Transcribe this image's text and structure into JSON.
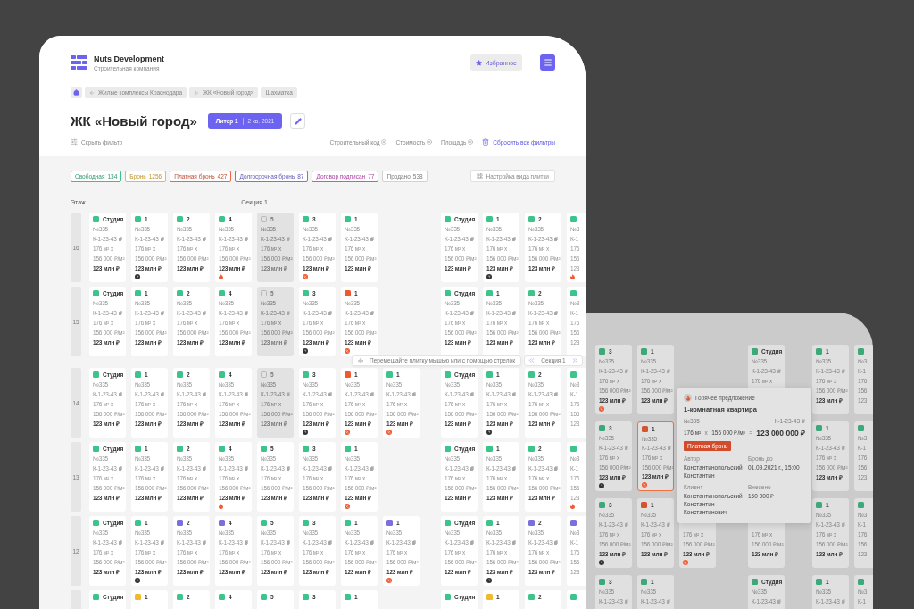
{
  "header": {
    "company": "Nuts Development",
    "subtitle": "Строительная компания",
    "favorites": "Избранное"
  },
  "breadcrumbs": [
    {
      "kind": "home"
    },
    {
      "kind": "back",
      "label": "Жилые комплексы Краснодара"
    },
    {
      "kind": "back",
      "label": "ЖК «Новый город»"
    },
    {
      "kind": "plain",
      "label": "Шахматка"
    }
  ],
  "title": {
    "text": "ЖК «Новый город»",
    "building": "Литер 1",
    "quarter": "2 кв. 2021"
  },
  "filters": {
    "toggle": "Скрыть фильтр",
    "chips": [
      "Строительный код",
      "Стоимость",
      "Площадь"
    ],
    "reset": "Сбросить все фильтры"
  },
  "legend": [
    {
      "label": "Свободная",
      "count": "134",
      "color": "#3fc089"
    },
    {
      "label": "Бронь",
      "count": "1256",
      "color": "#f0b83a"
    },
    {
      "label": "Платная бронь",
      "count": "427",
      "color": "#ec6547"
    },
    {
      "label": "Долгосрочная бронь",
      "count": "87",
      "color": "#7a72e6"
    },
    {
      "label": "Договор подписан",
      "count": "77",
      "color": "#d24fc6"
    },
    {
      "label": "Продано",
      "count": "538",
      "color": "#d2d2d2"
    }
  ],
  "view_settings": "Настройка вида плитки",
  "floors": {
    "floor_label": "Этаж",
    "section_label": "Секция 1",
    "rows": [
      {
        "floor": "16",
        "section_1": [
          {
            "kind": "full",
            "color": "#3cc48a",
            "rooms": "Студия",
            "number": "№335",
            "code": "К-1-23-43",
            "area": "176 м²",
            "op": "x",
            "price": "156 000 ₽/м²",
            "total": "123 млн ₽"
          },
          {
            "kind": "full",
            "color": "#3cc48a",
            "rooms": "1",
            "number": "№335",
            "code": "К-1-23-43",
            "area": "176 м²",
            "op": "x",
            "price": "156 000 ₽/м²",
            "total": "123 млн ₽",
            "badge": {
              "kind": "clock"
            }
          },
          {
            "kind": "full",
            "color": "#3cc48a",
            "rooms": "2",
            "number": "№335",
            "code": "К-1-23-43",
            "area": "176 м²",
            "op": "x",
            "price": "156 000 ₽/м²",
            "total": "123 млн ₽"
          },
          {
            "kind": "full",
            "color": "#3cc48a",
            "rooms": "4",
            "number": "№335",
            "code": "К-1-23-43",
            "area": "176 м²",
            "op": "x",
            "price": "156 000 ₽/м²",
            "total": "123 млн ₽",
            "badge": {
              "kind": "fire"
            }
          },
          {
            "kind": "sold",
            "rooms": "5",
            "number": "№335",
            "code": "К-1-23-43",
            "area": "176 м²",
            "op": "x",
            "price": "156 000 ₽/м²",
            "total": "123 млн ₽"
          },
          {
            "kind": "full",
            "color": "#3cc48a",
            "rooms": "3",
            "number": "№335",
            "code": "К-1-23-43",
            "area": "176 м²",
            "op": "x",
            "price": "156 000 ₽/м²",
            "total": "123 млн ₽",
            "badge": {
              "kind": "percent"
            }
          },
          {
            "kind": "full",
            "color": "#3cc48a",
            "rooms": "1",
            "number": "№335",
            "code": "К-1-23-43",
            "area": "176 м²",
            "op": "x",
            "price": "156 000 ₽/м²",
            "total": "123 млн ₽"
          },
          {
            "kind": "empty"
          }
        ],
        "section_2": [
          {
            "kind": "full",
            "color": "#3cc48a",
            "rooms": "Студия",
            "number": "№335",
            "code": "К-1-23-43",
            "area": "176 м²",
            "op": "x",
            "price": "156 000 ₽/м²",
            "total": "123 млн ₽"
          },
          {
            "kind": "full",
            "color": "#3cc48a",
            "rooms": "1",
            "number": "№335",
            "code": "К-1-23-43",
            "area": "176 м²",
            "op": "x",
            "price": "156 000 ₽/м²",
            "total": "123 млн ₽",
            "badge": {
              "kind": "clock"
            }
          },
          {
            "kind": "full",
            "color": "#3cc48a",
            "rooms": "2",
            "number": "№335",
            "code": "К-1-23-43",
            "area": "176 м²",
            "op": "x",
            "price": "156 000 ₽/м²",
            "total": "123 млн ₽"
          },
          {
            "kind": "cut",
            "color": "#3cc48a",
            "lines": [
              "№3",
              "К-1",
              "176",
              "156",
              "123"
            ],
            "badge": {
              "kind": "fire"
            }
          }
        ]
      },
      {
        "floor": "15",
        "section_1": [
          {
            "kind": "full",
            "color": "#3cc48a",
            "rooms": "Студия",
            "number": "№335",
            "code": "К-1-23-43",
            "area": "176 м²",
            "op": "x",
            "price": "156 000 ₽/м²",
            "total": "123 млн ₽"
          },
          {
            "kind": "full",
            "color": "#3cc48a",
            "rooms": "1",
            "number": "№335",
            "code": "К-1-23-43",
            "area": "176 м²",
            "op": "x",
            "price": "156 000 ₽/м²",
            "total": "123 млн ₽"
          },
          {
            "kind": "full",
            "color": "#3cc48a",
            "rooms": "2",
            "number": "№335",
            "code": "К-1-23-43",
            "area": "176 м²",
            "op": "x",
            "price": "156 000 ₽/м²",
            "total": "123 млн ₽"
          },
          {
            "kind": "full",
            "color": "#3cc48a",
            "rooms": "4",
            "number": "№335",
            "code": "К-1-23-43",
            "area": "176 м²",
            "op": "x",
            "price": "156 000 ₽/м²",
            "total": "123 млн ₽"
          },
          {
            "kind": "sold",
            "rooms": "5",
            "number": "№335",
            "code": "К-1-23-43",
            "area": "176 м²",
            "op": "x",
            "price": "156 000 ₽/м²",
            "total": "123 млн ₽"
          },
          {
            "kind": "full",
            "color": "#3cc48a",
            "rooms": "3",
            "number": "№335",
            "code": "К-1-23-43",
            "area": "176 м²",
            "op": "x",
            "price": "156 000 ₽/м²",
            "total": "123 млн ₽",
            "badge": {
              "kind": "clock"
            }
          },
          {
            "kind": "full",
            "color": "#f0582f",
            "rooms": "1",
            "number": "№335",
            "code": "К-1-23-43",
            "area": "176 м²",
            "op": "x",
            "price": "156 000 ₽/м²",
            "total": "123 млн ₽",
            "badge": {
              "kind": "percent"
            }
          },
          {
            "kind": "empty"
          }
        ],
        "section_2": [
          {
            "kind": "full",
            "color": "#3cc48a",
            "rooms": "Студия",
            "number": "№335",
            "code": "К-1-23-43",
            "area": "176 м²",
            "op": "x",
            "price": "156 000 ₽/м²",
            "total": "123 млн ₽"
          },
          {
            "kind": "full",
            "color": "#3cc48a",
            "rooms": "1",
            "number": "№335",
            "code": "К-1-23-43",
            "area": "176 м²",
            "op": "x",
            "price": "156 000 ₽/м²",
            "total": "123 млн ₽"
          },
          {
            "kind": "full",
            "color": "#3cc48a",
            "rooms": "2",
            "number": "№335",
            "code": "К-1-23-43",
            "area": "176 м²",
            "op": "x",
            "price": "156 000 ₽/м²",
            "total": "123 млн ₽"
          },
          {
            "kind": "cut",
            "color": "#3cc48a",
            "lines": [
              "№3",
              "К-1",
              "176",
              "156",
              "123"
            ]
          }
        ]
      },
      {
        "floor": "14",
        "section_1": [
          {
            "kind": "full",
            "color": "#3cc48a",
            "rooms": "Студия",
            "number": "№335",
            "code": "К-1-23-43",
            "area": "176 м²",
            "op": "x",
            "price": "156 000 ₽/м²",
            "total": "123 млн ₽"
          },
          {
            "kind": "full",
            "color": "#3cc48a",
            "rooms": "1",
            "number": "№335",
            "code": "К-1-23-43",
            "area": "176 м²",
            "op": "x",
            "price": "156 000 ₽/м²",
            "total": "123 млн ₽"
          },
          {
            "kind": "full",
            "color": "#3cc48a",
            "rooms": "2",
            "number": "№335",
            "code": "К-1-23-43",
            "area": "176 м²",
            "op": "x",
            "price": "156 000 ₽/м²",
            "total": "123 млн ₽"
          },
          {
            "kind": "full",
            "color": "#3cc48a",
            "rooms": "4",
            "number": "№335",
            "code": "К-1-23-43",
            "area": "176 м²",
            "op": "x",
            "price": "156 000 ₽/м²",
            "total": "123 млн ₽"
          },
          {
            "kind": "sold",
            "rooms": "5",
            "number": "№335",
            "code": "К-1-23-43",
            "area": "176 м²",
            "op": "x",
            "price": "156 000 ₽/м²",
            "total": "123 млн ₽"
          },
          {
            "kind": "full",
            "color": "#3cc48a",
            "rooms": "3",
            "number": "№335",
            "code": "К-1-23-43",
            "area": "176 м²",
            "op": "x",
            "price": "156 000 ₽/м²",
            "total": "123 млн ₽",
            "badge": {
              "kind": "clock"
            }
          },
          {
            "kind": "full",
            "color": "#f0582f",
            "rooms": "1",
            "number": "№335",
            "code": "К-1-23-43",
            "area": "176 м²",
            "op": "x",
            "price": "156 000 ₽/м²",
            "total": "123 млн ₽",
            "badge": {
              "kind": "percent"
            }
          },
          {
            "kind": "full",
            "color": "#3cc48a",
            "rooms": "1",
            "number": "№335",
            "code": "К-1-23-43",
            "area": "176 м²",
            "op": "x",
            "price": "156 000 ₽/м²",
            "total": "123 млн ₽",
            "badge": {
              "kind": "percent"
            }
          }
        ],
        "section_2": [
          {
            "kind": "full",
            "color": "#3cc48a",
            "rooms": "Студия",
            "number": "№335",
            "code": "К-1-23-43",
            "area": "176 м²",
            "op": "x",
            "price": "156 000 ₽/м²",
            "total": "123 млн ₽"
          },
          {
            "kind": "full",
            "color": "#3cc48a",
            "rooms": "1",
            "number": "№335",
            "code": "К-1-23-43",
            "area": "176 м²",
            "op": "x",
            "price": "156 000 ₽/м²",
            "total": "123 млн ₽",
            "badge": {
              "kind": "clock"
            }
          },
          {
            "kind": "full",
            "color": "#3cc48a",
            "rooms": "2",
            "number": "№335",
            "code": "К-1-23-43",
            "area": "176 м²",
            "op": "x",
            "price": "156 000 ₽/м²",
            "total": "123 млн ₽"
          },
          {
            "kind": "cut",
            "color": "#3cc48a",
            "lines": [
              "№3",
              "К-1",
              "176",
              "156",
              "123"
            ]
          }
        ]
      },
      {
        "floor": "13",
        "section_1": [
          {
            "kind": "full",
            "color": "#3cc48a",
            "rooms": "Студия",
            "number": "№335",
            "code": "К-1-23-43",
            "area": "176 м²",
            "op": "x",
            "price": "156 000 ₽/м²",
            "total": "123 млн ₽"
          },
          {
            "kind": "full",
            "color": "#3cc48a",
            "rooms": "1",
            "number": "№335",
            "code": "К-1-23-43",
            "area": "176 м²",
            "op": "x",
            "price": "156 000 ₽/м²",
            "total": "123 млн ₽"
          },
          {
            "kind": "full",
            "color": "#3cc48a",
            "rooms": "2",
            "number": "№335",
            "code": "К-1-23-43",
            "area": "176 м²",
            "op": "x",
            "price": "156 000 ₽/м²",
            "total": "123 млн ₽"
          },
          {
            "kind": "full",
            "color": "#3cc48a",
            "rooms": "4",
            "number": "№335",
            "code": "К-1-23-43",
            "area": "176 м²",
            "op": "x",
            "price": "156 000 ₽/м²",
            "total": "123 млн ₽",
            "badge": {
              "kind": "fire"
            }
          },
          {
            "kind": "full",
            "color": "#3cc48a",
            "rooms": "5",
            "number": "№335",
            "code": "К-1-23-43",
            "area": "176 м²",
            "op": "x",
            "price": "156 000 ₽/м²",
            "total": "123 млн ₽"
          },
          {
            "kind": "full",
            "color": "#3cc48a",
            "rooms": "3",
            "number": "№335",
            "code": "К-1-23-43",
            "area": "176 м²",
            "op": "x",
            "price": "156 000 ₽/м²",
            "total": "123 млн ₽"
          },
          {
            "kind": "full",
            "color": "#3cc48a",
            "rooms": "1",
            "number": "№335",
            "code": "К-1-23-43",
            "area": "176 м²",
            "op": "x",
            "price": "156 000 ₽/м²",
            "total": "123 млн ₽",
            "badge": {
              "kind": "percent"
            }
          },
          {
            "kind": "empty"
          }
        ],
        "section_2": [
          {
            "kind": "full",
            "color": "#3cc48a",
            "rooms": "Студия",
            "number": "№335",
            "code": "К-1-23-43",
            "area": "176 м²",
            "op": "x",
            "price": "156 000 ₽/м²",
            "total": "123 млн ₽"
          },
          {
            "kind": "full",
            "color": "#3cc48a",
            "rooms": "1",
            "number": "№335",
            "code": "К-1-23-43",
            "area": "176 м²",
            "op": "x",
            "price": "156 000 ₽/м²",
            "total": "123 млн ₽"
          },
          {
            "kind": "full",
            "color": "#3cc48a",
            "rooms": "2",
            "number": "№335",
            "code": "К-1-23-43",
            "area": "176 м²",
            "op": "x",
            "price": "156 000 ₽/м²",
            "total": "123 млн ₽"
          },
          {
            "kind": "cut",
            "color": "#3cc48a",
            "lines": [
              "№3",
              "К-1",
              "176",
              "156",
              "123"
            ],
            "badge": {
              "kind": "fire"
            }
          }
        ]
      },
      {
        "floor": "12",
        "section_1": [
          {
            "kind": "full",
            "color": "#3cc48a",
            "rooms": "Студия",
            "number": "№335",
            "code": "К-1-23-43",
            "area": "176 м²",
            "op": "x",
            "price": "156 000 ₽/м²",
            "total": "123 млн ₽"
          },
          {
            "kind": "full",
            "color": "#3cc48a",
            "rooms": "1",
            "number": "№335",
            "code": "К-1-23-43",
            "area": "176 м²",
            "op": "x",
            "price": "156 000 ₽/м²",
            "total": "123 млн ₽",
            "badge": {
              "kind": "clock"
            }
          },
          {
            "kind": "full",
            "color": "#7b6fe0",
            "rooms": "2",
            "number": "№335",
            "code": "К-1-23-43",
            "area": "176 м²",
            "op": "x",
            "price": "156 000 ₽/м²",
            "total": "123 млн ₽"
          },
          {
            "kind": "full",
            "color": "#7b6fe0",
            "rooms": "4",
            "number": "№335",
            "code": "К-1-23-43",
            "area": "176 м²",
            "op": "x",
            "price": "156 000 ₽/м²",
            "total": "123 млн ₽"
          },
          {
            "kind": "full",
            "color": "#3cc48a",
            "rooms": "5",
            "number": "№335",
            "code": "К-1-23-43",
            "area": "176 м²",
            "op": "x",
            "price": "156 000 ₽/м²",
            "total": "123 млн ₽"
          },
          {
            "kind": "full",
            "color": "#3cc48a",
            "rooms": "3",
            "number": "№335",
            "code": "К-1-23-43",
            "area": "176 м²",
            "op": "x",
            "price": "156 000 ₽/м²",
            "total": "123 млн ₽"
          },
          {
            "kind": "full",
            "color": "#3cc48a",
            "rooms": "1",
            "number": "№335",
            "code": "К-1-23-43",
            "area": "176 м²",
            "op": "x",
            "price": "156 000 ₽/м²",
            "total": "123 млн ₽"
          },
          {
            "kind": "full",
            "color": "#7b6fe0",
            "rooms": "1",
            "number": "№335",
            "code": "К-1-23-43",
            "area": "176 м²",
            "op": "x",
            "price": "156 000 ₽/м²",
            "total": "123 млн ₽",
            "badge": {
              "kind": "percent"
            }
          }
        ],
        "section_2": [
          {
            "kind": "full",
            "color": "#3cc48a",
            "rooms": "Студия",
            "number": "№335",
            "code": "К-1-23-43",
            "area": "176 м²",
            "op": "x",
            "price": "156 000 ₽/м²",
            "total": "123 млн ₽"
          },
          {
            "kind": "full",
            "color": "#3cc48a",
            "rooms": "1",
            "number": "№335",
            "code": "К-1-23-43",
            "area": "176 м²",
            "op": "x",
            "price": "156 000 ₽/м²",
            "total": "123 млн ₽",
            "badge": {
              "kind": "clock"
            }
          },
          {
            "kind": "full",
            "color": "#7b6fe0",
            "rooms": "2",
            "number": "№335",
            "code": "К-1-23-43",
            "area": "176 м²",
            "op": "x",
            "price": "156 000 ₽/м²",
            "total": "123 млн ₽"
          },
          {
            "kind": "cut",
            "color": "#7b6fe0",
            "lines": [
              "№3",
              "К-1",
              "176",
              "156",
              "123"
            ]
          }
        ]
      },
      {
        "section_1": [
          {
            "kind": "full",
            "color": "#3cc48a",
            "rooms": "Студия"
          },
          {
            "kind": "full",
            "color": "#f2b92b",
            "rooms": "1"
          },
          {
            "kind": "full",
            "color": "#3cc48a",
            "rooms": "2"
          },
          {
            "kind": "full",
            "color": "#3cc48a",
            "rooms": "4"
          },
          {
            "kind": "full",
            "color": "#3cc48a",
            "rooms": "5"
          },
          {
            "kind": "full",
            "color": "#3cc48a",
            "rooms": "3"
          },
          {
            "kind": "full",
            "color": "#3cc48a",
            "rooms": "1"
          },
          {
            "kind": "empty"
          }
        ],
        "section_2": [
          {
            "kind": "full",
            "color": "#3cc48a",
            "rooms": "Студия"
          },
          {
            "kind": "full",
            "color": "#f2b92b",
            "rooms": "1"
          },
          {
            "kind": "full",
            "color": "#3cc48a",
            "rooms": "2"
          },
          {
            "kind": "cut",
            "color": "#3cc48a"
          }
        ]
      }
    ]
  },
  "drag_hint": "Перемещайте плитку мышью или с помощью стрелок",
  "section_switcher": "Секция 1",
  "detail_view": {
    "rows": [
      {
        "tiles": [
          {
            "kind": "full",
            "selected": false,
            "color": "#3fa878",
            "rooms": "3",
            "number": "№335",
            "code": "К-1-23-43",
            "area": "176 м²",
            "op": "x",
            "price": "156 000 ₽/м²",
            "total": "123 млн ₽",
            "badge": {
              "kind": "percent"
            }
          },
          {
            "kind": "full",
            "selected": false,
            "color": "#3fa878",
            "rooms": "1",
            "number": "№335",
            "code": "К-1-23-43",
            "area": "176 м²",
            "op": "x",
            "price": "156 000 ₽/м²",
            "total": "123 млн ₽"
          },
          {
            "kind": "empty"
          },
          {
            "kind": "full",
            "selected": false,
            "color": "#3fa878",
            "rooms": "Студия",
            "number": "№335",
            "code": "К-1-23-43",
            "area": "176 м²",
            "op": "x"
          },
          {
            "kind": "full",
            "selected": false,
            "color": "#3fa878",
            "rooms": "1",
            "number": "№335",
            "code": "К-1-23-43",
            "area": "176 м²",
            "op": "x",
            "price": "156 000 ₽/м²",
            "total": "123 млн ₽"
          },
          {
            "kind": "cut",
            "selected": false,
            "color": "#3fa878",
            "lines": [
              "№3",
              "К-1",
              "176",
              "156",
              "123"
            ]
          }
        ]
      },
      {
        "tiles": [
          {
            "kind": "full",
            "selected": false,
            "color": "#3fa878",
            "rooms": "3",
            "number": "№335",
            "code": "К-1-23-43",
            "area": "176 м²",
            "op": "x",
            "price": "156 000 ₽/м²",
            "total": "123 млн ₽",
            "badge": {
              "kind": "clock"
            }
          },
          {
            "kind": "full",
            "selected": true,
            "color": "#d6532f",
            "rooms": "1",
            "number": "№335",
            "code": "К-1-23-43",
            "area": "176 м²",
            "op": "x",
            "price": "156 000 ₽/м²",
            "total": "123 млн ₽",
            "badge": {
              "kind": "percent"
            }
          },
          {
            "kind": "empty"
          },
          {
            "kind": "empty"
          },
          {
            "kind": "full",
            "selected": false,
            "color": "#3fa878",
            "rooms": "1",
            "number": "№335",
            "code": "К-1-23-43",
            "area": "176 м²",
            "op": "x",
            "price": "156 000 ₽/м²",
            "total": "123 млн ₽"
          },
          {
            "kind": "cut",
            "selected": false,
            "color": "#3fa878",
            "lines": [
              "№3",
              "К-1",
              "176",
              "156",
              "123"
            ]
          }
        ]
      },
      {
        "tiles": [
          {
            "kind": "full",
            "selected": false,
            "color": "#3fa878",
            "rooms": "3",
            "number": "№335",
            "code": "К-1-23-43",
            "area": "176 м²",
            "op": "x",
            "price": "156 000 ₽/м²",
            "total": "123 млн ₽",
            "badge": {
              "kind": "clock"
            }
          },
          {
            "kind": "full",
            "selected": false,
            "color": "#d6532f",
            "rooms": "1",
            "number": "№335",
            "code": "К-1-23-43",
            "area": "176 м²",
            "op": "x",
            "price": "156 000 ₽/м²",
            "total": "123 млн ₽"
          },
          {
            "kind": "full",
            "selected": false,
            "area": "176 м²",
            "op": "x",
            "price": "156 000 ₽/м²",
            "total": "123 млн ₽",
            "badge": {
              "kind": "percent"
            }
          },
          {
            "kind": "full",
            "selected": false,
            "area": "176 м²",
            "op": "x",
            "price": "156 000 ₽/м²",
            "total": "123 млн ₽"
          },
          {
            "kind": "full",
            "selected": false,
            "color": "#3fa878",
            "rooms": "1",
            "number": "№335",
            "code": "К-1-23-43",
            "area": "176 м²",
            "op": "x",
            "price": "156 000 ₽/м²",
            "total": "123 млн ₽"
          },
          {
            "kind": "cut",
            "selected": false,
            "color": "#3fa878",
            "lines": [
              "№3",
              "К-1",
              "176",
              "156",
              "123"
            ]
          }
        ]
      },
      {
        "tiles": [
          {
            "kind": "full",
            "selected": false,
            "color": "#3fa878",
            "rooms": "3",
            "number": "№335",
            "code": "К-1-23-43"
          },
          {
            "kind": "full",
            "selected": false,
            "color": "#3fa878",
            "rooms": "1",
            "number": "№335",
            "code": "К-1-23-43"
          },
          {
            "kind": "empty"
          },
          {
            "kind": "full",
            "selected": false,
            "color": "#3fa878",
            "rooms": "Студия",
            "number": "№335",
            "code": "К-1-23-43"
          },
          {
            "kind": "full",
            "selected": false,
            "color": "#3fa878",
            "rooms": "1",
            "number": "№335",
            "code": "К-1-23-43"
          },
          {
            "kind": "cut",
            "selected": false,
            "color": "#3fa878",
            "lines": [
              "№3",
              "К-1"
            ]
          }
        ]
      }
    ],
    "popup": {
      "tag": "Горячее предложение",
      "title": "1-комнатная квартира",
      "number": "№335",
      "code": "К-1-23-43",
      "area": "176 м²",
      "op1": "x",
      "price": "156 000 ₽/м²",
      "op2": "=",
      "total": "123 000 000 ₽",
      "status": "Платная бронь",
      "fields": [
        {
          "label": "Автор",
          "value": "Константинопольский Константин"
        },
        {
          "label": "Бронь до",
          "value": "01.09.2021 г., 15:00"
        },
        {
          "label": "Клиент",
          "value": "Константинопольский Константин Константинович"
        },
        {
          "label": "Внесено",
          "value": "150 000 ₽"
        }
      ]
    }
  }
}
